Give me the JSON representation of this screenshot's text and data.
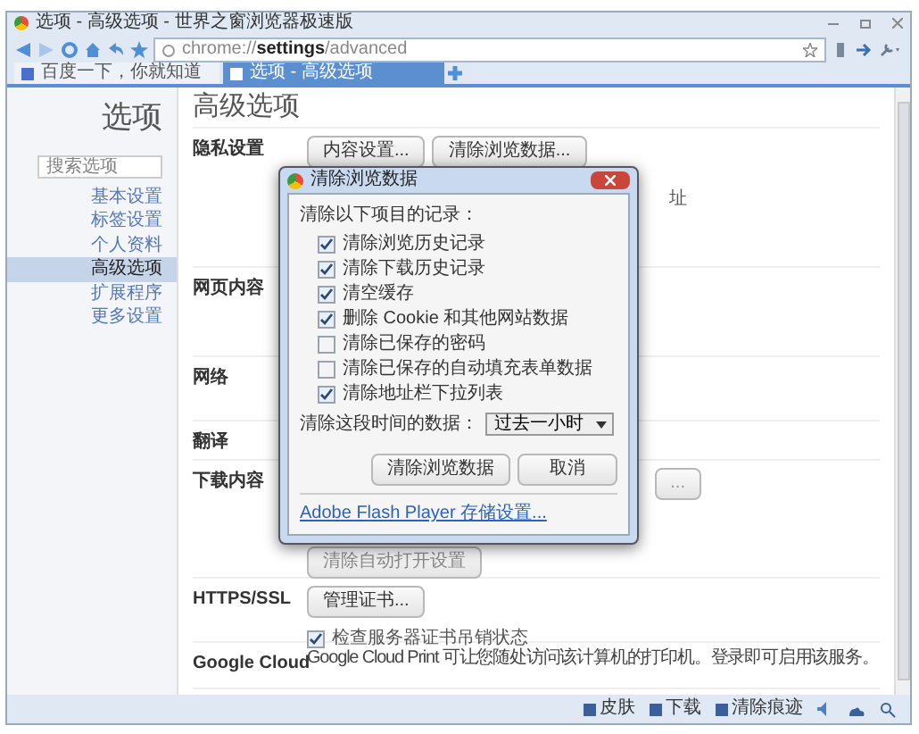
{
  "window": {
    "title": "选项 - 高级选项 - 世界之窗浏览器极速版"
  },
  "address": {
    "scheme": "chrome://",
    "host": "settings",
    "path": "/advanced"
  },
  "tabs": [
    {
      "label": "百度一下，你就知道",
      "selected": false
    },
    {
      "label": "选项 - 高级选项",
      "selected": true
    }
  ],
  "sidebar": {
    "title": "选项",
    "search_placeholder": "搜索选项",
    "items": [
      {
        "label": "基本设置",
        "selected": false
      },
      {
        "label": "标签设置",
        "selected": false
      },
      {
        "label": "个人资料",
        "selected": false
      },
      {
        "label": "高级选项",
        "selected": true
      },
      {
        "label": "扩展程序",
        "selected": false
      },
      {
        "label": "更多设置",
        "selected": false
      }
    ]
  },
  "page": {
    "title": "高级选项",
    "sections": [
      {
        "label": "隐私设置",
        "buttons": [
          "内容设置...",
          "清除浏览数据..."
        ],
        "peek": "址"
      },
      {
        "label": "网页内容"
      },
      {
        "label": "网络"
      },
      {
        "label": "翻译"
      },
      {
        "label": "下载内容",
        "peek_button": "...",
        "buttons_below": [
          "清除自动打开设置"
        ]
      },
      {
        "label": "HTTPS/SSL",
        "buttons": [
          "管理证书..."
        ],
        "checkbox": {
          "label": "检查服务器证书吊销状态",
          "checked": true
        }
      },
      {
        "label": "Google Cloud",
        "text": "Google Cloud Print 可让您随处访问该计算机的打印机。登录即可启用该服务。"
      }
    ]
  },
  "dialog": {
    "title": "清除浏览数据",
    "intro": "清除以下项目的记录：",
    "options": [
      {
        "label": "清除浏览历史记录",
        "checked": true
      },
      {
        "label": "清除下载历史记录",
        "checked": true
      },
      {
        "label": "清空缓存",
        "checked": true
      },
      {
        "label": "删除 Cookie 和其他网站数据",
        "checked": true
      },
      {
        "label": "清除已保存的密码",
        "checked": false
      },
      {
        "label": "清除已保存的自动填充表单数据",
        "checked": false
      },
      {
        "label": "清除地址栏下拉列表",
        "checked": true
      }
    ],
    "period_label": "清除这段时间的数据：",
    "period_value": "过去一小时",
    "buttons": [
      "清除浏览数据",
      "取消"
    ],
    "link": "Adobe Flash Player 存储设置..."
  },
  "status_bar": {
    "items": [
      "皮肤",
      "下载",
      "清除痕迹"
    ]
  }
}
